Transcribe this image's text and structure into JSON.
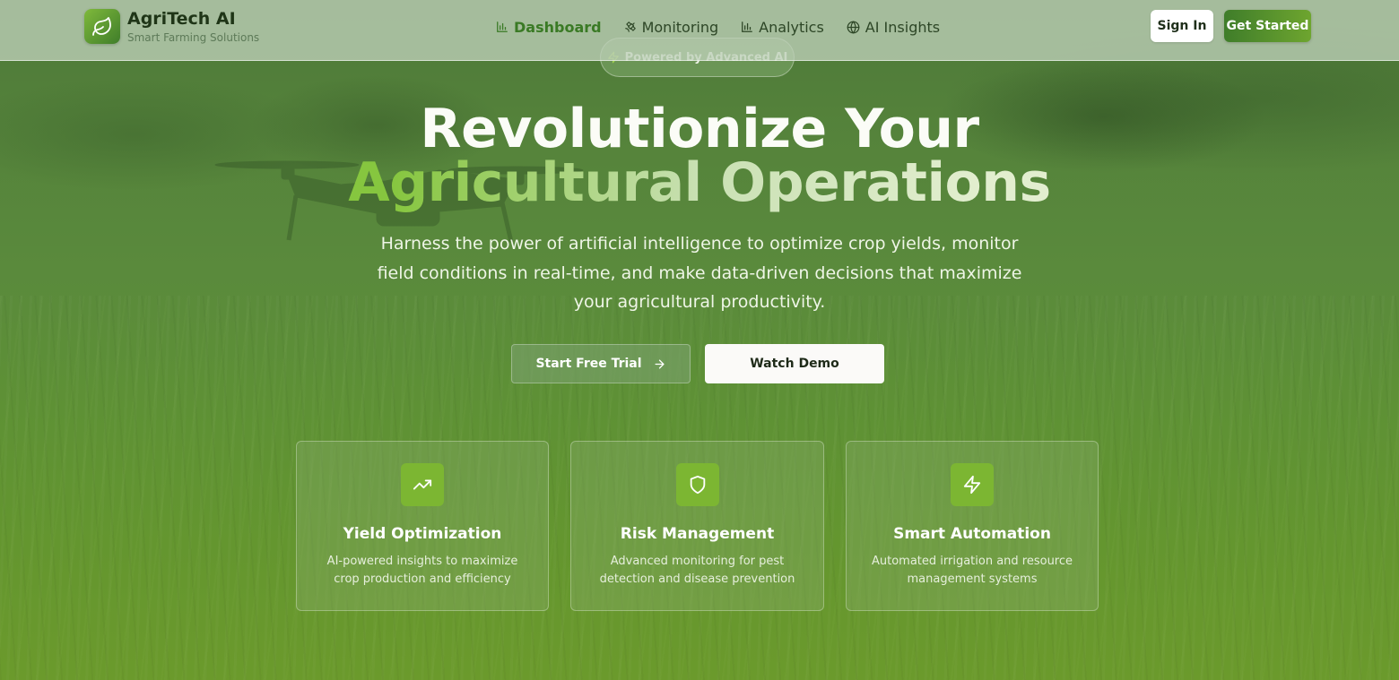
{
  "brand": {
    "name": "AgriTech AI",
    "tagline": "Smart Farming Solutions"
  },
  "nav": {
    "items": [
      {
        "label": "Dashboard",
        "icon": "bar-chart-icon",
        "active": true
      },
      {
        "label": "Monitoring",
        "icon": "satellite-icon",
        "active": false
      },
      {
        "label": "Analytics",
        "icon": "bar-chart-icon",
        "active": false
      },
      {
        "label": "AI Insights",
        "icon": "globe-icon",
        "active": false
      }
    ]
  },
  "header": {
    "signin_label": "Sign In",
    "get_started_label": "Get Started"
  },
  "hero": {
    "badge": "Powered by Advanced AI",
    "title_line1": "Revolutionize Your",
    "title_line2": "Agricultural Operations",
    "subtitle": "Harness the power of artificial intelligence to optimize crop yields, monitor field conditions in real-time, and make data-driven decisions that maximize your agricultural productivity.",
    "primary_cta": "Start Free Trial",
    "secondary_cta": "Watch Demo"
  },
  "features": [
    {
      "icon": "trending-up-icon",
      "title": "Yield Optimization",
      "description": "AI-powered insights to maximize crop production and efficiency"
    },
    {
      "icon": "shield-icon",
      "title": "Risk Management",
      "description": "Advanced monitoring for pest detection and disease prevention"
    },
    {
      "icon": "lightning-icon",
      "title": "Smart Automation",
      "description": "Automated irrigation and resource management systems"
    }
  ],
  "colors": {
    "accent_green": "#7cb632",
    "dark_green": "#3f7d2a",
    "header_bg": "#bed0b9"
  }
}
